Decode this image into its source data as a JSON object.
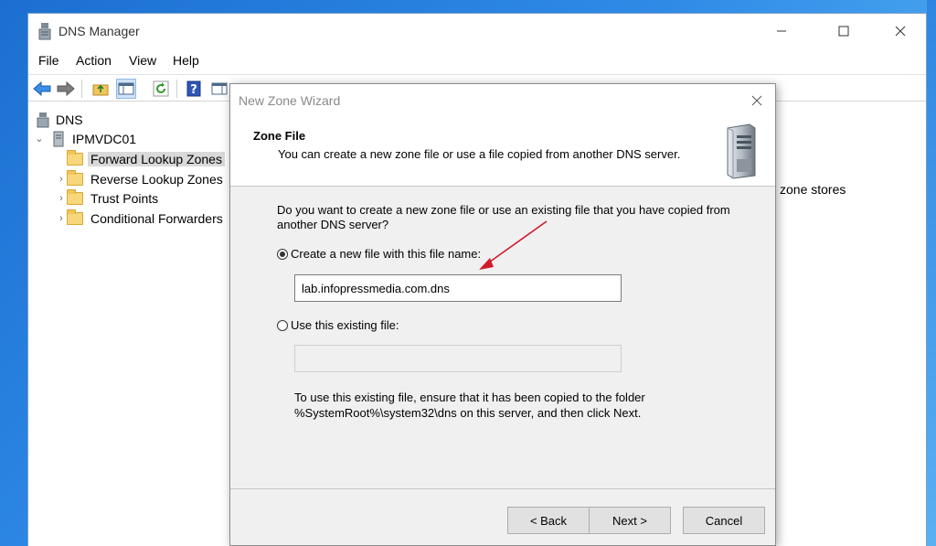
{
  "main_window": {
    "title": "DNS Manager",
    "menu": [
      "File",
      "Action",
      "View",
      "Help"
    ]
  },
  "tree": {
    "root": "DNS",
    "server": "IPMVDC01",
    "items": [
      {
        "label": "Forward Lookup Zones",
        "selected": true
      },
      {
        "label": "Reverse Lookup Zones"
      },
      {
        "label": "Trust Points"
      },
      {
        "label": "Conditional Forwarders"
      }
    ]
  },
  "right_pane": {
    "partial_text": "zone stores"
  },
  "wizard": {
    "title": "New Zone Wizard",
    "heading": "Zone File",
    "subheading": "You can create a new zone file or use a file copied from another DNS server.",
    "question_line1": "Do you want to create a new zone file or use an existing file that you have copied from",
    "question_line2": "another DNS server?",
    "option_new_label": "Create a new file with this file name:",
    "option_new_value": "lab.infopressmedia.com.dns",
    "option_existing_label": "Use this existing file:",
    "option_existing_value": "",
    "info_line1": "To use this existing file, ensure that it has been copied to the folder",
    "info_line2": "%SystemRoot%\\system32\\dns on this server, and then click Next.",
    "buttons": {
      "back": "< Back",
      "next": "Next >",
      "cancel": "Cancel"
    }
  },
  "colors": {
    "annotation_arrow": "#d11a2a",
    "folder": "#f7d77c",
    "selection": "#d9d9d9"
  },
  "icons": {
    "app": "dns-server-icon",
    "toolbar": [
      "back-arrow-icon",
      "forward-arrow-icon",
      "up-folder-icon",
      "show-hide-tree-icon",
      "refresh-icon",
      "help-icon",
      "properties-icon"
    ]
  }
}
